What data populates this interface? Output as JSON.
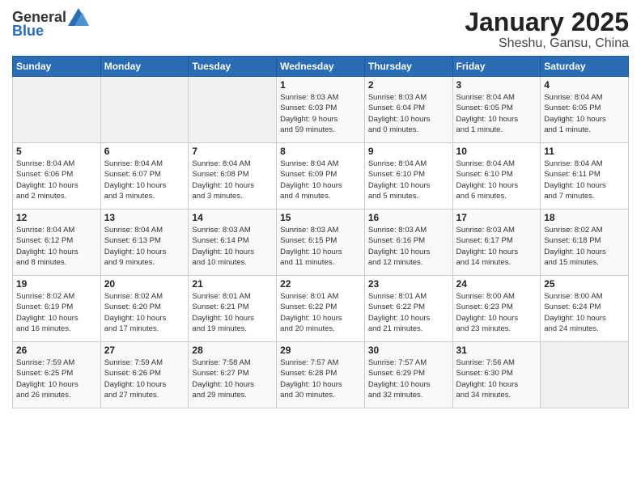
{
  "header": {
    "logo_general": "General",
    "logo_blue": "Blue",
    "month": "January 2025",
    "location": "Sheshu, Gansu, China"
  },
  "weekdays": [
    "Sunday",
    "Monday",
    "Tuesday",
    "Wednesday",
    "Thursday",
    "Friday",
    "Saturday"
  ],
  "weeks": [
    [
      {
        "day": "",
        "info": ""
      },
      {
        "day": "",
        "info": ""
      },
      {
        "day": "",
        "info": ""
      },
      {
        "day": "1",
        "info": "Sunrise: 8:03 AM\nSunset: 6:03 PM\nDaylight: 9 hours\nand 59 minutes."
      },
      {
        "day": "2",
        "info": "Sunrise: 8:03 AM\nSunset: 6:04 PM\nDaylight: 10 hours\nand 0 minutes."
      },
      {
        "day": "3",
        "info": "Sunrise: 8:04 AM\nSunset: 6:05 PM\nDaylight: 10 hours\nand 1 minute."
      },
      {
        "day": "4",
        "info": "Sunrise: 8:04 AM\nSunset: 6:05 PM\nDaylight: 10 hours\nand 1 minute."
      }
    ],
    [
      {
        "day": "5",
        "info": "Sunrise: 8:04 AM\nSunset: 6:06 PM\nDaylight: 10 hours\nand 2 minutes."
      },
      {
        "day": "6",
        "info": "Sunrise: 8:04 AM\nSunset: 6:07 PM\nDaylight: 10 hours\nand 3 minutes."
      },
      {
        "day": "7",
        "info": "Sunrise: 8:04 AM\nSunset: 6:08 PM\nDaylight: 10 hours\nand 3 minutes."
      },
      {
        "day": "8",
        "info": "Sunrise: 8:04 AM\nSunset: 6:09 PM\nDaylight: 10 hours\nand 4 minutes."
      },
      {
        "day": "9",
        "info": "Sunrise: 8:04 AM\nSunset: 6:10 PM\nDaylight: 10 hours\nand 5 minutes."
      },
      {
        "day": "10",
        "info": "Sunrise: 8:04 AM\nSunset: 6:10 PM\nDaylight: 10 hours\nand 6 minutes."
      },
      {
        "day": "11",
        "info": "Sunrise: 8:04 AM\nSunset: 6:11 PM\nDaylight: 10 hours\nand 7 minutes."
      }
    ],
    [
      {
        "day": "12",
        "info": "Sunrise: 8:04 AM\nSunset: 6:12 PM\nDaylight: 10 hours\nand 8 minutes."
      },
      {
        "day": "13",
        "info": "Sunrise: 8:04 AM\nSunset: 6:13 PM\nDaylight: 10 hours\nand 9 minutes."
      },
      {
        "day": "14",
        "info": "Sunrise: 8:03 AM\nSunset: 6:14 PM\nDaylight: 10 hours\nand 10 minutes."
      },
      {
        "day": "15",
        "info": "Sunrise: 8:03 AM\nSunset: 6:15 PM\nDaylight: 10 hours\nand 11 minutes."
      },
      {
        "day": "16",
        "info": "Sunrise: 8:03 AM\nSunset: 6:16 PM\nDaylight: 10 hours\nand 12 minutes."
      },
      {
        "day": "17",
        "info": "Sunrise: 8:03 AM\nSunset: 6:17 PM\nDaylight: 10 hours\nand 14 minutes."
      },
      {
        "day": "18",
        "info": "Sunrise: 8:02 AM\nSunset: 6:18 PM\nDaylight: 10 hours\nand 15 minutes."
      }
    ],
    [
      {
        "day": "19",
        "info": "Sunrise: 8:02 AM\nSunset: 6:19 PM\nDaylight: 10 hours\nand 16 minutes."
      },
      {
        "day": "20",
        "info": "Sunrise: 8:02 AM\nSunset: 6:20 PM\nDaylight: 10 hours\nand 17 minutes."
      },
      {
        "day": "21",
        "info": "Sunrise: 8:01 AM\nSunset: 6:21 PM\nDaylight: 10 hours\nand 19 minutes."
      },
      {
        "day": "22",
        "info": "Sunrise: 8:01 AM\nSunset: 6:22 PM\nDaylight: 10 hours\nand 20 minutes."
      },
      {
        "day": "23",
        "info": "Sunrise: 8:01 AM\nSunset: 6:22 PM\nDaylight: 10 hours\nand 21 minutes."
      },
      {
        "day": "24",
        "info": "Sunrise: 8:00 AM\nSunset: 6:23 PM\nDaylight: 10 hours\nand 23 minutes."
      },
      {
        "day": "25",
        "info": "Sunrise: 8:00 AM\nSunset: 6:24 PM\nDaylight: 10 hours\nand 24 minutes."
      }
    ],
    [
      {
        "day": "26",
        "info": "Sunrise: 7:59 AM\nSunset: 6:25 PM\nDaylight: 10 hours\nand 26 minutes."
      },
      {
        "day": "27",
        "info": "Sunrise: 7:59 AM\nSunset: 6:26 PM\nDaylight: 10 hours\nand 27 minutes."
      },
      {
        "day": "28",
        "info": "Sunrise: 7:58 AM\nSunset: 6:27 PM\nDaylight: 10 hours\nand 29 minutes."
      },
      {
        "day": "29",
        "info": "Sunrise: 7:57 AM\nSunset: 6:28 PM\nDaylight: 10 hours\nand 30 minutes."
      },
      {
        "day": "30",
        "info": "Sunrise: 7:57 AM\nSunset: 6:29 PM\nDaylight: 10 hours\nand 32 minutes."
      },
      {
        "day": "31",
        "info": "Sunrise: 7:56 AM\nSunset: 6:30 PM\nDaylight: 10 hours\nand 34 minutes."
      },
      {
        "day": "",
        "info": ""
      }
    ]
  ]
}
